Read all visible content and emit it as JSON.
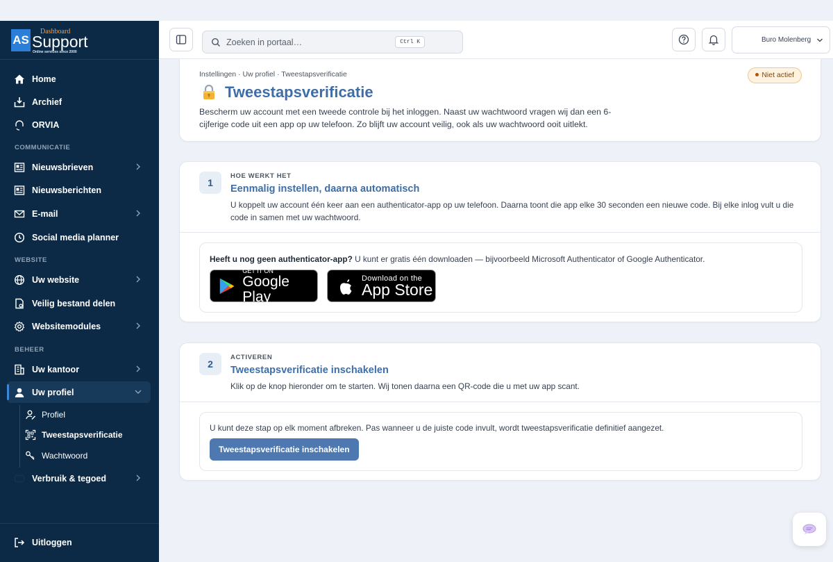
{
  "brand": {
    "logo_mark": "AS",
    "logo_top": "Dashboard",
    "logo_main": "Support",
    "logo_tagline": "Online services since 2000"
  },
  "sidebar": {
    "items": [
      {
        "label": "Home",
        "icon": "home-icon"
      },
      {
        "label": "Archief",
        "icon": "archive-icon"
      },
      {
        "label": "ORVIA",
        "icon": "headset-icon"
      }
    ],
    "sections": {
      "communicatie": "COMMUNICATIE",
      "website": "WEBSITE",
      "beheer": "BEHEER"
    },
    "communicatie": [
      {
        "label": "Nieuwsbrieven"
      },
      {
        "label": "Nieuwsberichten"
      },
      {
        "label": "E-mail"
      },
      {
        "label": "Social media planner"
      }
    ],
    "website": [
      {
        "label": "Uw website"
      },
      {
        "label": "Veilig bestand delen"
      },
      {
        "label": "Websitemodules"
      }
    ],
    "beheer": [
      {
        "label": "Uw kantoor"
      },
      {
        "label": "Uw profiel"
      },
      {
        "label": "Verbruik & tegoed"
      }
    ],
    "profiel_sub": [
      {
        "label": "Profiel"
      },
      {
        "label": "Tweestapsverificatie"
      },
      {
        "label": "Wachtwoord"
      }
    ],
    "logout": "Uitloggen"
  },
  "header": {
    "search_placeholder": "Zoeken in portaal…",
    "shortcut": "Ctrl K",
    "user_name": "Buro Molenberg"
  },
  "page": {
    "breadcrumb": "Instellingen · Uw profiel · Tweestapsverificatie",
    "title": "Tweestapsverificatie",
    "description": "Bescherm uw account met een tweede controle bij het inloggen. Naast uw wachtwoord vragen wij dan een 6-cijferige code uit een app op uw telefoon. Zo blijft uw account veilig, ook als uw wachtwoord ooit uitlekt.",
    "status": "Niet actief",
    "status_color": "#b45309"
  },
  "step1": {
    "number": "1",
    "kicker": "HOE WERKT HET",
    "title": "Eenmalig instellen, daarna automatisch",
    "description": "U koppelt uw account één keer aan een authenticator-app op uw telefoon. Daarna toont die app elke 30 seconden een nieuwe code. Bij elke inlog vult u die code in samen met uw wachtwoord.",
    "callout_bold": "Heeft u nog geen authenticator-app?",
    "callout_text": " U kunt er gratis één downloaden — bijvoorbeeld Microsoft Authenticator of Google Authenticator.",
    "google_play_small": "GET IT ON",
    "google_play_big": "Google Play",
    "app_store_small": "Download on the",
    "app_store_big": "App Store"
  },
  "step2": {
    "number": "2",
    "kicker": "ACTIVEREN",
    "title": "Tweestapsverificatie inschakelen",
    "description": "Klik op de knop hieronder om te starten. Wij tonen daarna een QR-code die u met uw app scant.",
    "note": "U kunt deze stap op elk moment afbreken. Pas wanneer u de juiste code invult, wordt tweestapsverificatie definitief aangezet.",
    "button": "Tweestapsverificatie inschakelen"
  },
  "colors": {
    "sidebar_bg": "#0c2a45",
    "accent": "#3e6ea8",
    "primary_button": "#4d78b0"
  }
}
